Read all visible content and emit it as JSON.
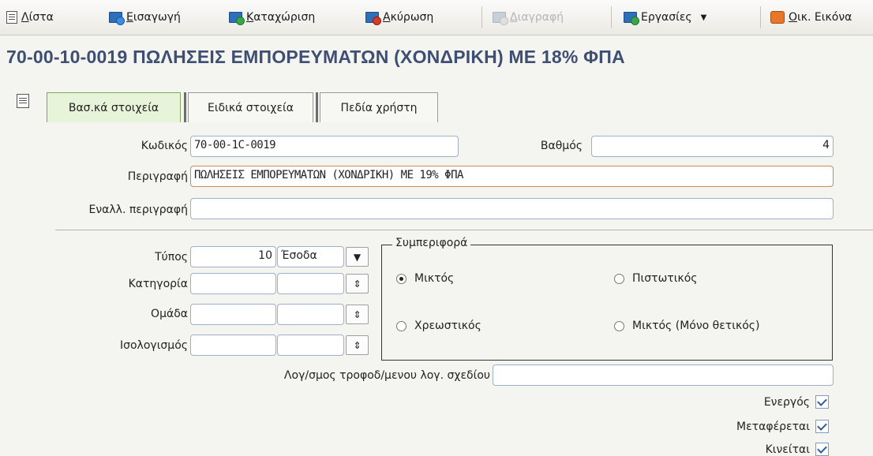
{
  "toolbar": {
    "list": {
      "underline": "Λ",
      "rest": "ίστα"
    },
    "import": {
      "underline": "Ε",
      "rest": "ισαγωγή"
    },
    "save": {
      "underline": "Κ",
      "rest": "αταχώριση"
    },
    "cancel": {
      "underline": "Α",
      "rest": "κύρωση"
    },
    "delete": {
      "underline": "Δ",
      "rest": "ιαγραφή"
    },
    "tasks": "Εργασίες",
    "econ": {
      "underline": "Ο",
      "rest": "ικ. Εικόνα"
    }
  },
  "page_title": "70-00-10-0019 ΠΩΛΗΣΕΙΣ ΕΜΠΟΡΕΥΜΑΤΩΝ (ΧΟΝΔΡΙΚΗ) ΜΕ 18% ΦΠΑ",
  "tabs": [
    "Βασ.κά στοιχεία",
    "Ειδικά στοιχεία",
    "Πεδία χρήστη"
  ],
  "form": {
    "code_label": "Κωδικός",
    "code_value": "70-00-1C-0019",
    "level_label": "Βαθμός",
    "level_value": "4",
    "desc_label": "Περιγραφή",
    "desc_value": "ΠΩΛΗΣΕΙΣ ΕΜΠΟΡΕΥΜΑΤΩΝ (ΧΟΝΔΡΙΚΗ) ΜΕ 19% ΦΠΑ",
    "alt_desc_label": "Εναλλ. περιγραφή",
    "alt_desc_value": "",
    "type_label": "Τύπος",
    "type_code": "10",
    "type_name": "Έσοδα",
    "category_label": "Κατηγορία",
    "group_label": "Ομάδα",
    "balance_label": "Ισολογισμός",
    "behavior_legend": "Συμπεριφορά",
    "radio_mixed": "Μικτός",
    "radio_credit": "Πιστωτικός",
    "radio_debit": "Χρεωστικός",
    "radio_mixed_positive": "Μικτός (Μόνο θετικός)",
    "modified_plan_label": "Λογ/σμος τροφοδ/μενου λογ. σχεδίου",
    "modified_plan_value": "",
    "active_label": "Ενεργός",
    "transferred_label": "Μεταφέρεται",
    "moves_label": "Κινείται"
  }
}
